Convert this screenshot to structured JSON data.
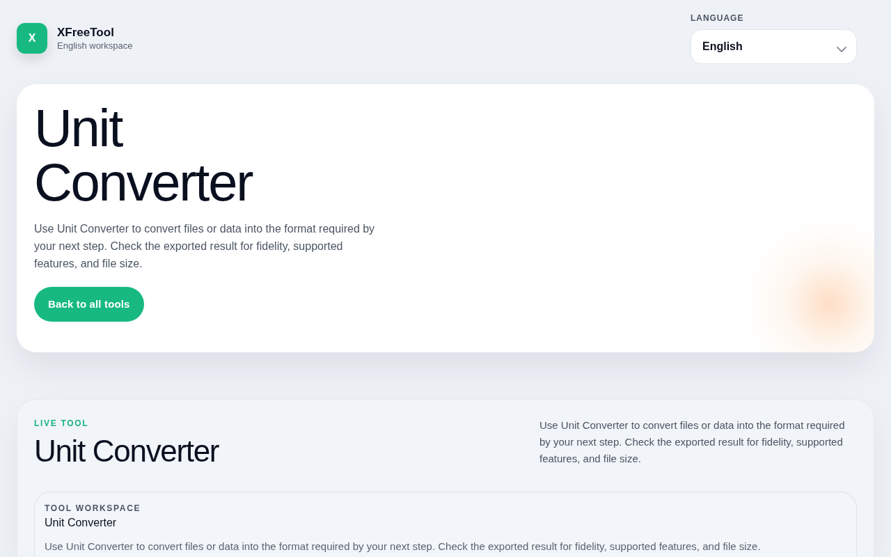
{
  "brand": {
    "logo_letter": "X",
    "name": "XFreeTool",
    "subtitle": "English workspace"
  },
  "language": {
    "label": "LANGUAGE",
    "value": "English"
  },
  "hero": {
    "title": "Unit Converter",
    "description": "Use Unit Converter to convert files or data into the format required by your next step. Check the exported result for fidelity, supported features, and file size.",
    "button": "Back to all tools"
  },
  "live_tool": {
    "eyebrow": "LIVE TOOL",
    "title": "Unit Converter",
    "description": "Use Unit Converter to convert files or data into the format required by your next step. Check the exported result for fidelity, supported features, and file size."
  },
  "workspace": {
    "eyebrow": "TOOL WORKSPACE",
    "title": "Unit Converter",
    "description": "Use Unit Converter to convert files or data into the format required by your next step. Check the exported result for fidelity, supported features, and file size."
  }
}
